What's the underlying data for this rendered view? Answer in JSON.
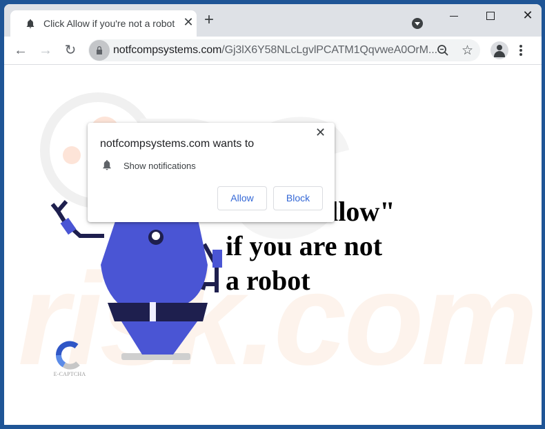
{
  "browser": {
    "tab": {
      "title": "Click Allow if you're not a robot",
      "icon": "bell-icon"
    },
    "new_tab_label": "+",
    "url": {
      "domain": "notfcompsystems.com",
      "path": "/Gj3lX6Y58NLcLgvlPCATM1QqvweA0OrM..."
    },
    "window_controls": [
      "minimize",
      "maximize",
      "close"
    ]
  },
  "permission_popup": {
    "title": "notfcompsystems.com wants to",
    "permission": "Show notifications",
    "close_label": "✕",
    "allow_label": "Allow",
    "block_label": "Block"
  },
  "page": {
    "headline_lines": [
      "Click \"Allow\"",
      "if you are not",
      "a robot"
    ],
    "captcha_label": "E-CAPTCHA",
    "watermark": "PC risk.com"
  },
  "colors": {
    "window_frame": "#1f5596",
    "robot_body": "#4a55d4",
    "robot_dark": "#1e1f4e",
    "visor": "#17485a",
    "button_text": "#3367d6"
  }
}
